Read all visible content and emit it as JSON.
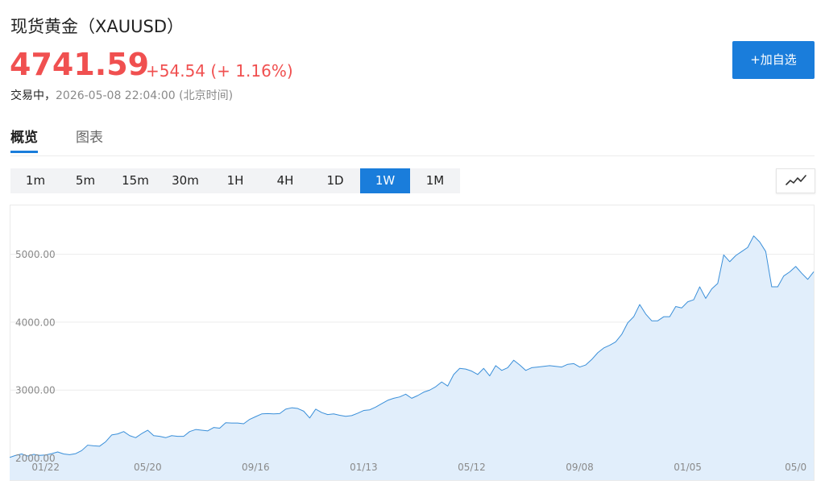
{
  "header": {
    "title": "现货黄金（XAUUSD）",
    "price": "4741.59",
    "change": "+54.54 (+ 1.16%)",
    "status_label": "交易中，",
    "timestamp": "2026-05-08 22:04:00 (北京时间)",
    "add_watchlist_label": "+加自选"
  },
  "tabs": [
    {
      "label": "概览",
      "active": true
    },
    {
      "label": "图表",
      "active": false
    }
  ],
  "intervals": [
    {
      "label": "1m",
      "active": false
    },
    {
      "label": "5m",
      "active": false
    },
    {
      "label": "15m",
      "active": false
    },
    {
      "label": "30m",
      "active": false
    },
    {
      "label": "1H",
      "active": false
    },
    {
      "label": "4H",
      "active": false
    },
    {
      "label": "1D",
      "active": false
    },
    {
      "label": "1W",
      "active": true
    },
    {
      "label": "1M",
      "active": false
    }
  ],
  "chart_type_icon": "line-chart-icon",
  "colors": {
    "accent": "#1a7ddb",
    "price_up": "#f05050",
    "line": "#3a8fd9",
    "area_fill": "#e1eefb",
    "grid": "#ececec",
    "axis_text": "#8a8a8a"
  },
  "chart_data": {
    "type": "area",
    "title": "",
    "xlabel": "",
    "ylabel": "",
    "ylim": [
      1675,
      5730
    ],
    "y_ticks": [
      "2000.00",
      "3000.00",
      "4000.00",
      "5000.00"
    ],
    "x_ticks": [
      "01/22",
      "05/20",
      "09/16",
      "01/13",
      "05/12",
      "09/08",
      "01/05",
      "05/0"
    ],
    "grid": true,
    "series": [
      {
        "name": "",
        "values": [
          2010,
          2040,
          2060,
          2030,
          2055,
          2040,
          2045,
          2065,
          2090,
          2060,
          2050,
          2065,
          2110,
          2190,
          2180,
          2175,
          2240,
          2340,
          2355,
          2390,
          2330,
          2300,
          2360,
          2410,
          2330,
          2320,
          2300,
          2330,
          2320,
          2320,
          2390,
          2420,
          2410,
          2400,
          2450,
          2440,
          2520,
          2515,
          2515,
          2505,
          2570,
          2610,
          2650,
          2655,
          2650,
          2655,
          2720,
          2740,
          2730,
          2690,
          2590,
          2720,
          2670,
          2640,
          2650,
          2630,
          2615,
          2625,
          2660,
          2700,
          2710,
          2750,
          2800,
          2850,
          2880,
          2900,
          2940,
          2880,
          2920,
          2970,
          3000,
          3050,
          3120,
          3060,
          3230,
          3320,
          3310,
          3280,
          3230,
          3320,
          3210,
          3360,
          3290,
          3330,
          3440,
          3370,
          3290,
          3330,
          3340,
          3350,
          3360,
          3350,
          3340,
          3380,
          3390,
          3340,
          3370,
          3450,
          3550,
          3620,
          3660,
          3710,
          3820,
          3990,
          4080,
          4260,
          4120,
          4020,
          4020,
          4080,
          4080,
          4230,
          4210,
          4300,
          4330,
          4520,
          4350,
          4490,
          4570,
          4990,
          4890,
          4980,
          5040,
          5100,
          5270,
          5180,
          5040,
          4520,
          4520,
          4680,
          4740,
          4820,
          4720,
          4630,
          4741.59
        ]
      }
    ],
    "x_tick_points": [
      6,
      23,
      41,
      59,
      77,
      95,
      113,
      131
    ]
  }
}
